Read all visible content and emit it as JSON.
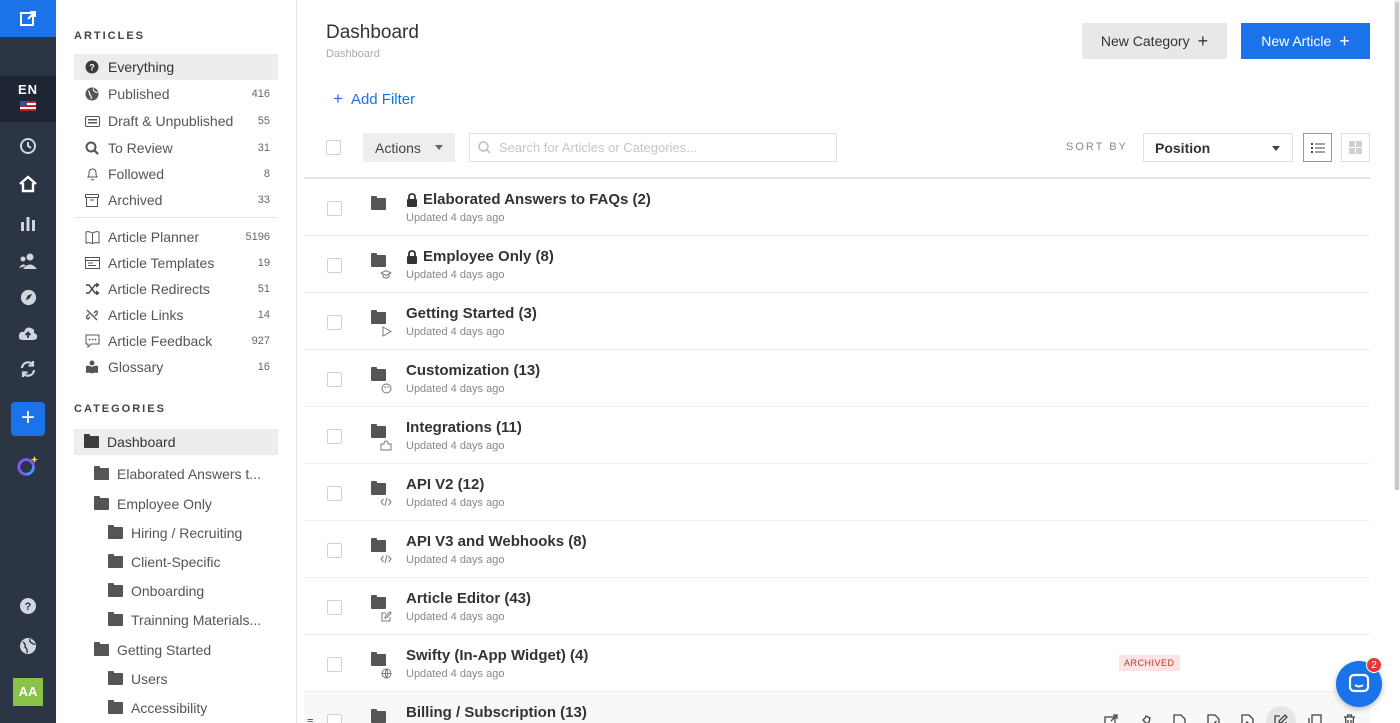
{
  "rail": {
    "lang_code": "EN",
    "avatar_initials": "AA",
    "icons": [
      "external-link-icon",
      "history-icon",
      "home-icon",
      "analytics-icon",
      "team-icon",
      "compass-icon",
      "cloud-upload-icon",
      "sync-icon",
      "plus-icon",
      "ai-assistant-icon",
      "help-icon",
      "globe-icon"
    ]
  },
  "sidebar": {
    "articles_title": "ARTICLES",
    "items": [
      {
        "label": "Everything",
        "count": "",
        "icon": "question-circle-icon"
      },
      {
        "label": "Published",
        "count": "416",
        "icon": "globe-icon"
      },
      {
        "label": "Draft & Unpublished",
        "count": "55",
        "icon": "keyboard-icon"
      },
      {
        "label": "To Review",
        "count": "31",
        "icon": "magnifier-icon"
      },
      {
        "label": "Followed",
        "count": "8",
        "icon": "bell-icon"
      },
      {
        "label": "Archived",
        "count": "33",
        "icon": "archive-box-icon"
      },
      {
        "label": "Article Planner",
        "count": "5196",
        "icon": "book-icon"
      },
      {
        "label": "Article Templates",
        "count": "19",
        "icon": "template-icon"
      },
      {
        "label": "Article Redirects",
        "count": "51",
        "icon": "shuffle-icon"
      },
      {
        "label": "Article Links",
        "count": "14",
        "icon": "broken-link-icon"
      },
      {
        "label": "Article Feedback",
        "count": "927",
        "icon": "comment-icon"
      },
      {
        "label": "Glossary",
        "count": "16",
        "icon": "glossary-icon"
      }
    ],
    "categories_title": "CATEGORIES",
    "categories": [
      {
        "label": "Dashboard"
      },
      {
        "label": "Elaborated Answers t..."
      },
      {
        "label": "Employee Only"
      },
      {
        "label": "Hiring / Recruiting"
      },
      {
        "label": "Client-Specific"
      },
      {
        "label": "Onboarding"
      },
      {
        "label": "Trainning Materials..."
      },
      {
        "label": "Getting Started"
      },
      {
        "label": "Users"
      },
      {
        "label": "Accessibility"
      }
    ]
  },
  "header": {
    "title": "Dashboard",
    "breadcrumb": "Dashboard",
    "new_category_label": "New Category",
    "new_article_label": "New Article",
    "plus": "+"
  },
  "toolbar": {
    "add_filter_label": "Add Filter",
    "actions_label": "Actions",
    "search_placeholder": "Search for Articles or Categories...",
    "sort_by_label": "SORT BY",
    "sort_value": "Position"
  },
  "rows": [
    {
      "title": "Elaborated Answers to FAQs (2)",
      "updated": "Updated 4 days ago"
    },
    {
      "title": "Employee Only (8)",
      "updated": "Updated 4 days ago"
    },
    {
      "title": "Getting Started (3)",
      "updated": "Updated 4 days ago"
    },
    {
      "title": "Customization (13)",
      "updated": "Updated 4 days ago"
    },
    {
      "title": "Integrations (11)",
      "updated": "Updated 4 days ago"
    },
    {
      "title": "API V2 (12)",
      "updated": "Updated 4 days ago"
    },
    {
      "title": "API V3 and Webhooks (8)",
      "updated": "Updated 4 days ago"
    },
    {
      "title": "Article Editor (43)",
      "updated": "Updated 4 days ago"
    },
    {
      "title": "Swifty (In-App Widget) (4)",
      "updated": "Updated 4 days ago",
      "badge": "ARCHIVED"
    },
    {
      "title": "Billing / Subscription (13)",
      "updated": ""
    }
  ],
  "chat": {
    "unread": "2"
  },
  "colors": {
    "accent": "#1a73e8",
    "rail": "#2b3544",
    "badge_bg": "#fce4e4",
    "badge_text": "#c0392b"
  }
}
